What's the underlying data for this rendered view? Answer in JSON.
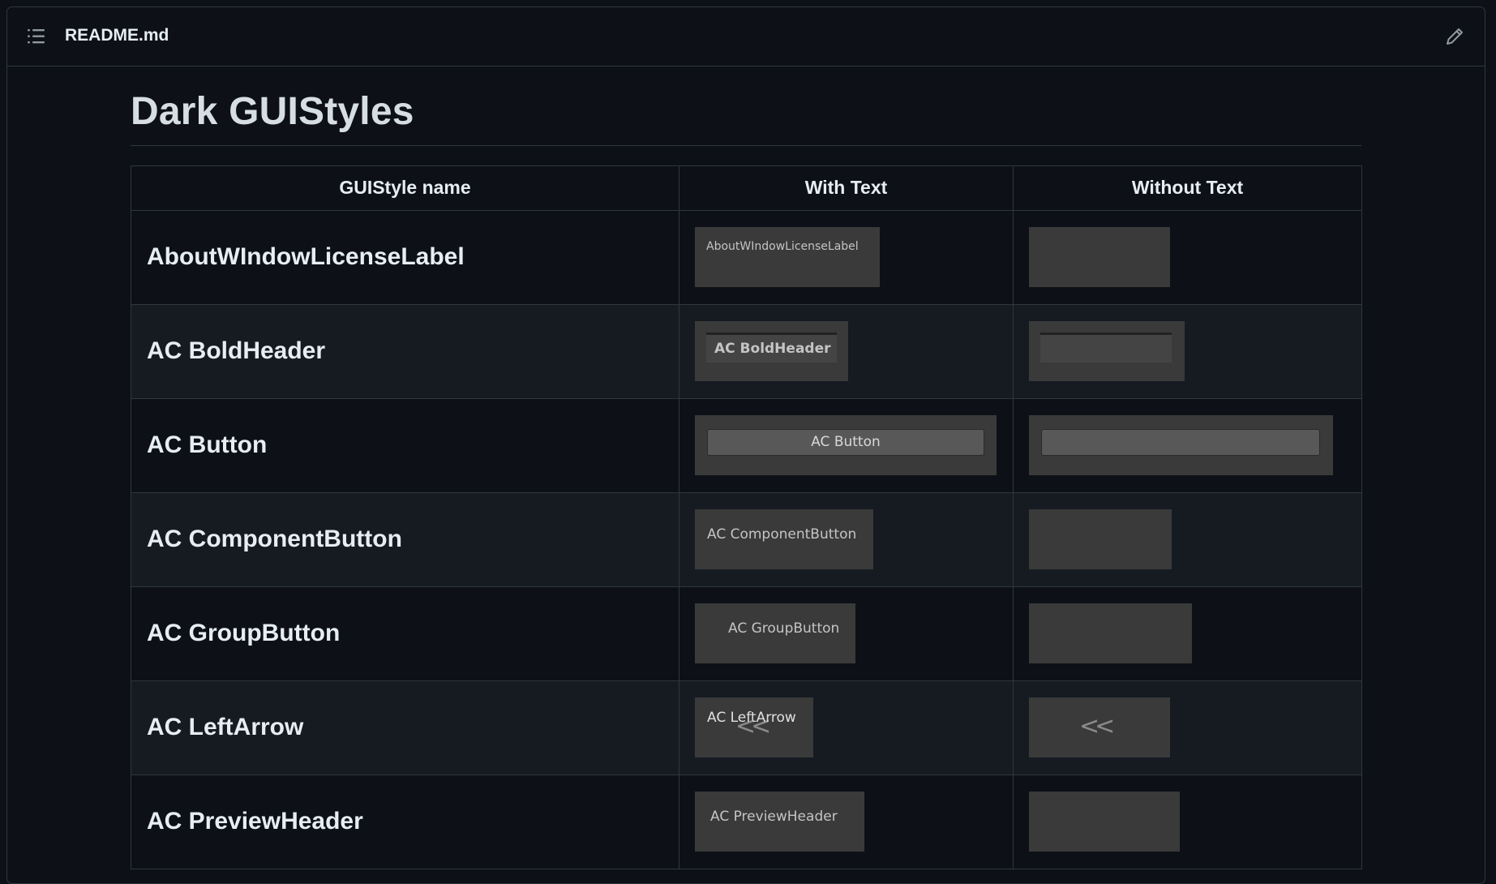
{
  "header": {
    "file_name": "README.md",
    "toc_icon": "list-icon",
    "edit_icon": "pencil-icon"
  },
  "title": "Dark GUIStyles",
  "table": {
    "columns": [
      "GUIStyle name",
      "With Text",
      "Without Text"
    ],
    "rows": [
      {
        "name": "AboutWIndowLicenseLabel",
        "with_text": "AboutWIndowLicenseLabel"
      },
      {
        "name": "AC BoldHeader",
        "with_text": "AC BoldHeader"
      },
      {
        "name": "AC Button",
        "with_text": "AC Button"
      },
      {
        "name": "AC ComponentButton",
        "with_text": "AC ComponentButton"
      },
      {
        "name": "AC GroupButton",
        "with_text": "AC GroupButton"
      },
      {
        "name": "AC LeftArrow",
        "with_text": "AC LeftArrow"
      },
      {
        "name": "AC PreviewHeader",
        "with_text": "AC PreviewHeader"
      }
    ]
  },
  "colors": {
    "page_bg": "#0d1117",
    "row_alt_bg": "#161b22",
    "border": "#30363d",
    "preview_bg": "#3a3a3a"
  }
}
